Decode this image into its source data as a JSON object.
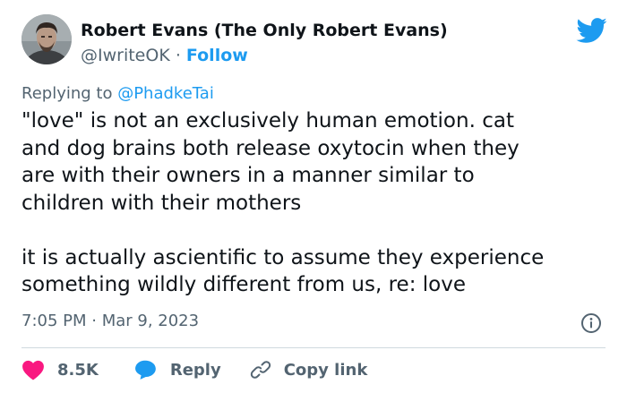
{
  "author": {
    "display_name": "Robert Evans (The Only Robert Evans)",
    "handle": "@IwriteOK",
    "separator": " · ",
    "follow_label": "Follow"
  },
  "reply_context": {
    "prefix": "Replying to ",
    "mention": "@PhadkeTai"
  },
  "tweet": {
    "text": "\"love\" is not an exclusively human emotion. cat\nand dog brains both release oxytocin when they\nare with their owners in a manner similar to\nchildren with their mothers\n\nit is actually ascientific to assume they experience\nsomething wildly different from us, re: love",
    "timestamp": "7:05 PM · Mar 9, 2023"
  },
  "actions": {
    "like_count": "8.5K",
    "reply_label": "Reply",
    "copy_link_label": "Copy link"
  },
  "colors": {
    "twitter_blue": "#1d9bf0",
    "like_red": "#f91880",
    "secondary_text": "#536471",
    "divider": "#cfd9de"
  },
  "icons": {
    "brand": "twitter-bird-icon",
    "info": "info-icon",
    "like": "heart-icon",
    "reply": "speech-bubble-icon",
    "copy_link": "link-icon"
  }
}
